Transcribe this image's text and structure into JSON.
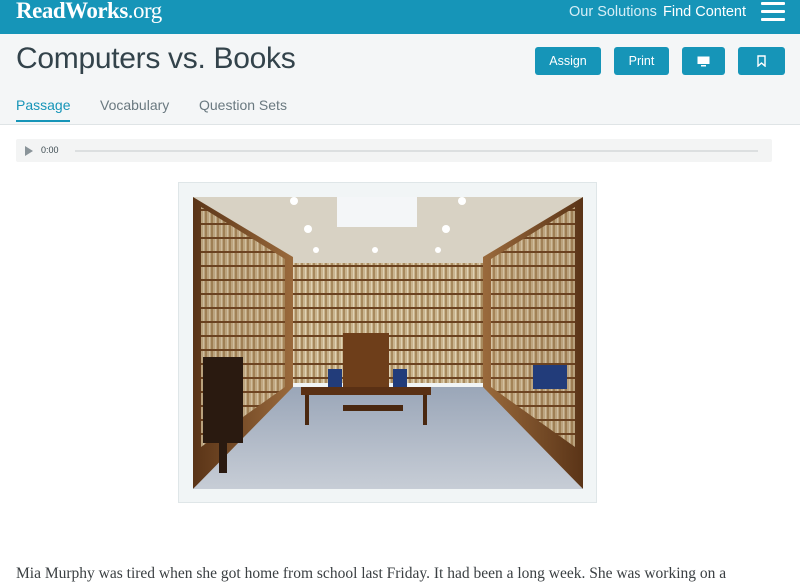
{
  "nav": {
    "logo_main": "ReadWorks",
    "logo_tld": ".org",
    "links": [
      "Our Solutions",
      "Find Content"
    ]
  },
  "header": {
    "title": "Computers vs. Books",
    "buttons": {
      "assign": "Assign",
      "print": "Print"
    },
    "tabs": [
      "Passage",
      "Vocabulary",
      "Question Sets"
    ],
    "active_tab": "Passage"
  },
  "audio": {
    "time": "0:00"
  },
  "passage": {
    "first_line": "Mia Murphy was tired when she got home from school last Friday. It had been a long week. She was working on a"
  },
  "colors": {
    "brand": "#1695b8",
    "header_bg": "#f4f6f7"
  },
  "icons": {
    "present": "monitor-icon",
    "bookmark": "bookmark-icon",
    "menu": "hamburger-icon",
    "play": "play-icon"
  }
}
